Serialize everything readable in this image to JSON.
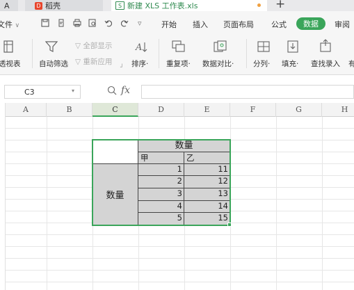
{
  "tabs": {
    "left_label": "A",
    "docer_label": "稻壳",
    "docer_logo": "D",
    "file_icon_label": "S",
    "file_label": "新建 XLS 工作表.xls",
    "plus": "+"
  },
  "menu": {
    "file": "文件",
    "chevron": "∨",
    "start": "开始",
    "insert": "插入",
    "page_layout": "页面布局",
    "formula": "公式",
    "data": "数据",
    "review": "审阅",
    "separator_caret": "▿"
  },
  "ribbon": {
    "pivot": "透视表",
    "auto_filter": "自动筛选",
    "show_all": "全部显示",
    "reapply": "重新应用",
    "sort": "排序",
    "duplicates": "重复项",
    "compare": "数据对比",
    "split": "分列",
    "fill": "填充",
    "lookup": "查找录入",
    "dropdown_caret": "·",
    "right_cut": "有"
  },
  "formula_bar": {
    "cell_ref": "C3",
    "dropdown": "▾",
    "fx": "fx",
    "zoom_glyph": "⊕",
    "value": ""
  },
  "columns": [
    "A",
    "B",
    "C",
    "D",
    "E",
    "F",
    "G",
    "H"
  ],
  "active_column": "C",
  "accent_color": "#3aa55a",
  "table": {
    "header_top": "数量",
    "col1": "甲",
    "col2": "乙",
    "row_label": "数量",
    "rows": [
      {
        "a": "1",
        "b": "11"
      },
      {
        "a": "2",
        "b": "12"
      },
      {
        "a": "3",
        "b": "13"
      },
      {
        "a": "4",
        "b": "14"
      },
      {
        "a": "5",
        "b": "15"
      }
    ]
  }
}
